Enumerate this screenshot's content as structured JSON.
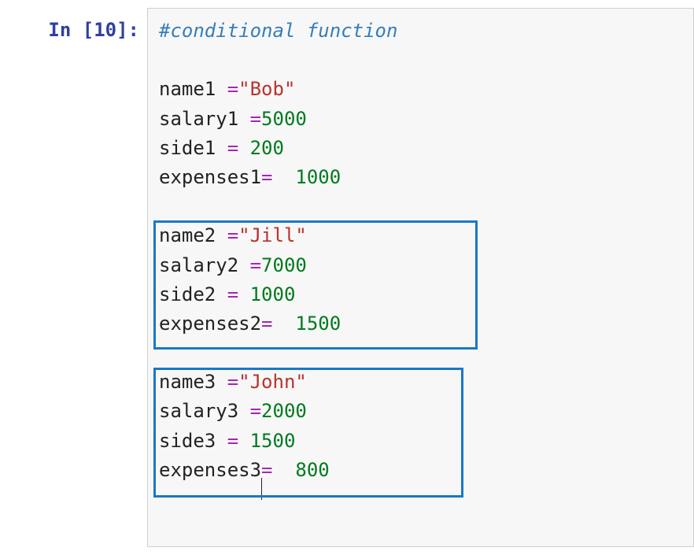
{
  "prompt": {
    "in": "In ",
    "lb": "[",
    "num": "10",
    "rb": "]:"
  },
  "code": {
    "l1_comment": "#conditional function",
    "l3_name1": "name1 ",
    "l3_eq": "=",
    "l3_val": "\"Bob\"",
    "l4_salary1": "salary1 ",
    "l4_eq": "=",
    "l4_val": "5000",
    "l5_side1": "side1 ",
    "l5_eq": "=",
    "l5_sp": " ",
    "l5_val": "200",
    "l6_exp1": "expenses1",
    "l6_eq": "=",
    "l6_sp": "  ",
    "l6_val": "1000",
    "l8_name2": "name2 ",
    "l8_eq": "=",
    "l8_val": "\"Jill\"",
    "l9_salary2": "salary2 ",
    "l9_eq": "=",
    "l9_val": "7000",
    "l10_side2": "side2 ",
    "l10_eq": "=",
    "l10_sp": " ",
    "l10_val": "1000",
    "l11_exp2": "expenses2",
    "l11_eq": "=",
    "l11_sp": "  ",
    "l11_val": "1500",
    "l13_name3": "name3 ",
    "l13_eq": "=",
    "l13_val": "\"John\"",
    "l14_salary3": "salary3 ",
    "l14_eq": "=",
    "l14_val": "2000",
    "l15_side3": "side3 ",
    "l15_eq": "=",
    "l15_sp": " ",
    "l15_val": "1500",
    "l16_exp3": "expenses3",
    "l16_eq": "=",
    "l16_sp": "  ",
    "l16_val": "800"
  }
}
